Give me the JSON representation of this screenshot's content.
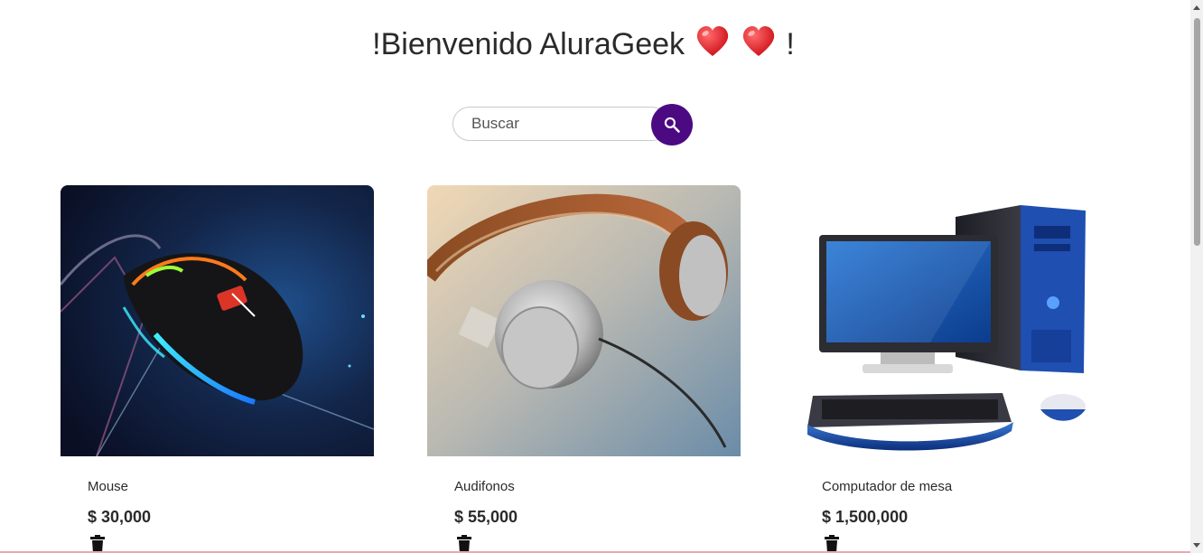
{
  "header": {
    "title_prefix": "!Bienvenido AluraGeek",
    "title_suffix": "!",
    "heart_color": "#e3262f"
  },
  "search": {
    "placeholder": "Buscar",
    "button_color": "#4b0a82"
  },
  "products": [
    {
      "name": "Mouse",
      "price": "$ 30,000"
    },
    {
      "name": "Audifonos",
      "price": "$ 55,000"
    },
    {
      "name": "Computador de mesa",
      "price": "$ 1,500,000"
    }
  ]
}
